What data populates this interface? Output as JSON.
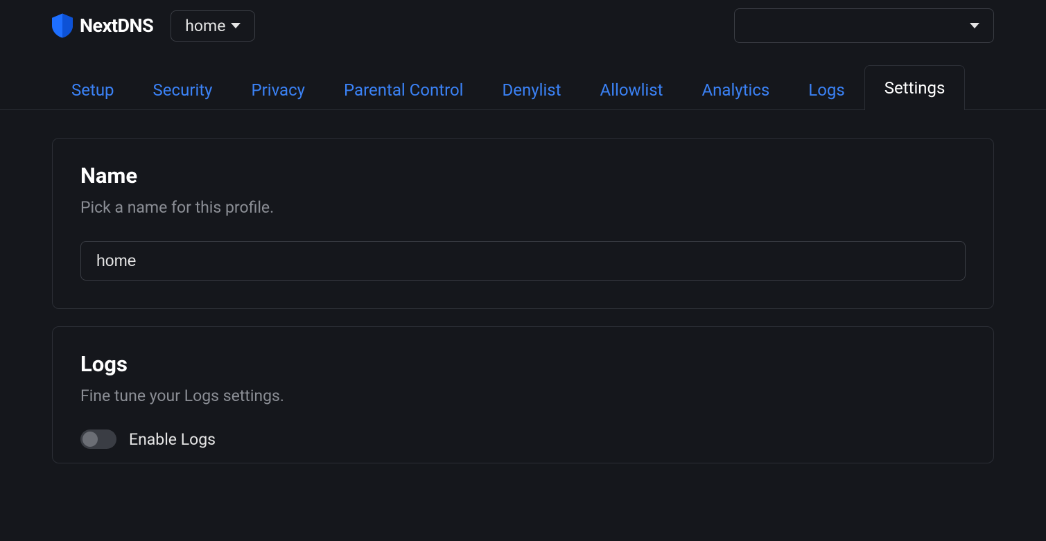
{
  "brand": "NextDNS",
  "profile_selector": {
    "selected": "home"
  },
  "tabs": [
    {
      "label": "Setup",
      "active": false
    },
    {
      "label": "Security",
      "active": false
    },
    {
      "label": "Privacy",
      "active": false
    },
    {
      "label": "Parental Control",
      "active": false
    },
    {
      "label": "Denylist",
      "active": false
    },
    {
      "label": "Allowlist",
      "active": false
    },
    {
      "label": "Analytics",
      "active": false
    },
    {
      "label": "Logs",
      "active": false
    },
    {
      "label": "Settings",
      "active": true
    }
  ],
  "sections": {
    "name": {
      "title": "Name",
      "description": "Pick a name for this profile.",
      "value": "home"
    },
    "logs": {
      "title": "Logs",
      "description": "Fine tune your Logs settings.",
      "enable_label": "Enable Logs",
      "enabled": false
    }
  },
  "colors": {
    "bg": "#15171c",
    "link": "#3b82f6",
    "border": "#2c2f36",
    "muted": "#8b8e95"
  }
}
